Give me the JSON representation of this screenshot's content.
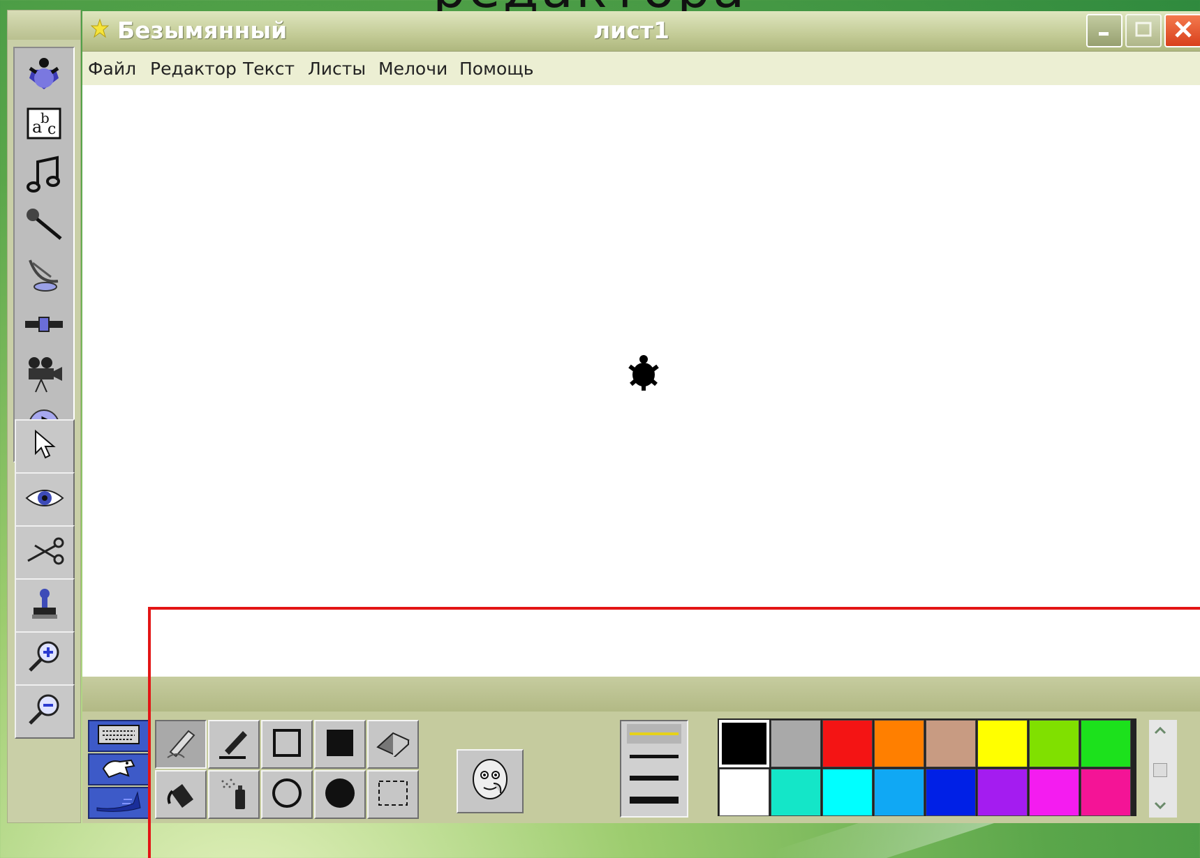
{
  "slide": {
    "title_fragment": "редактора"
  },
  "window": {
    "title": "Безымянный",
    "sheet": "лист1",
    "controls": {
      "minimize": "minimize",
      "maximize": "maximize",
      "close": "close"
    }
  },
  "menu": [
    "Файл",
    "Редактор",
    "Текст",
    "Листы",
    "Мелочи",
    "Помощь"
  ],
  "left_toolbox": {
    "media": [
      "turtle-icon",
      "text-box-icon",
      "music-notes-icon",
      "microphone-icon",
      "satellite-dish-icon",
      "slider-icon",
      "movie-camera-icon",
      "cd-music-icon"
    ],
    "tools": [
      "pointer-icon",
      "eye-icon",
      "scissors-icon",
      "stamp-icon",
      "zoom-in-icon",
      "zoom-out-icon"
    ]
  },
  "paint_panel": {
    "modes": [
      "keyboard-icon",
      "dog-icon",
      "shoe-icon"
    ],
    "tools": [
      "pencil-icon",
      "brush-icon",
      "rectangle-outline-icon",
      "rectangle-filled-icon",
      "eraser-icon",
      "paint-bucket-icon",
      "spray-can-icon",
      "ellipse-outline-icon",
      "ellipse-filled-icon",
      "selection-rect-icon"
    ],
    "face": "face-icon",
    "line_widths": [
      1,
      2,
      3,
      4
    ],
    "colors": {
      "selected": "#000000",
      "row1": [
        "#000000",
        "#a9a9a9",
        "#f41414",
        "#ff7f00",
        "#c89b82",
        "#ffff00",
        "#80e000",
        "#1ce11c"
      ],
      "row2": [
        "#ffffff",
        "#14e6c8",
        "#00ffff",
        "#10a8f4",
        "#0020e6",
        "#a41cf0",
        "#f41cf0",
        "#f41496"
      ]
    }
  }
}
